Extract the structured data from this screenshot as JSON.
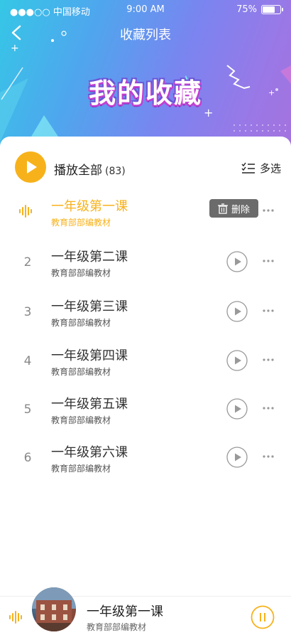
{
  "status": {
    "carrier": "●●●○○ 中国移动",
    "time": "9:00 AM",
    "battery": "75%",
    "battery_level": 0.75
  },
  "nav": {
    "title": "收藏列表"
  },
  "banner": {
    "title": "我的收藏"
  },
  "toolbar": {
    "play_all": "播放全部",
    "count": "(83)",
    "multi_select": "多选"
  },
  "tracks": [
    {
      "num": "",
      "title": "一年级第一课",
      "sub": "教育部部编教材",
      "active": true,
      "delete_label": "删除"
    },
    {
      "num": "2",
      "title": "一年级第二课",
      "sub": "教育部部编教材"
    },
    {
      "num": "3",
      "title": "一年级第三课",
      "sub": "教育部部编教材"
    },
    {
      "num": "4",
      "title": "一年级第四课",
      "sub": "教育部部编教材"
    },
    {
      "num": "5",
      "title": "一年级第五课",
      "sub": "教育部部编教材"
    },
    {
      "num": "6",
      "title": "一年级第六课",
      "sub": "教育部部编教材"
    }
  ],
  "player": {
    "title": "一年级第一课",
    "sub": "教育部部编教材"
  },
  "colors": {
    "accent": "#f7b21b",
    "delete_bg": "#6b6b6b"
  }
}
